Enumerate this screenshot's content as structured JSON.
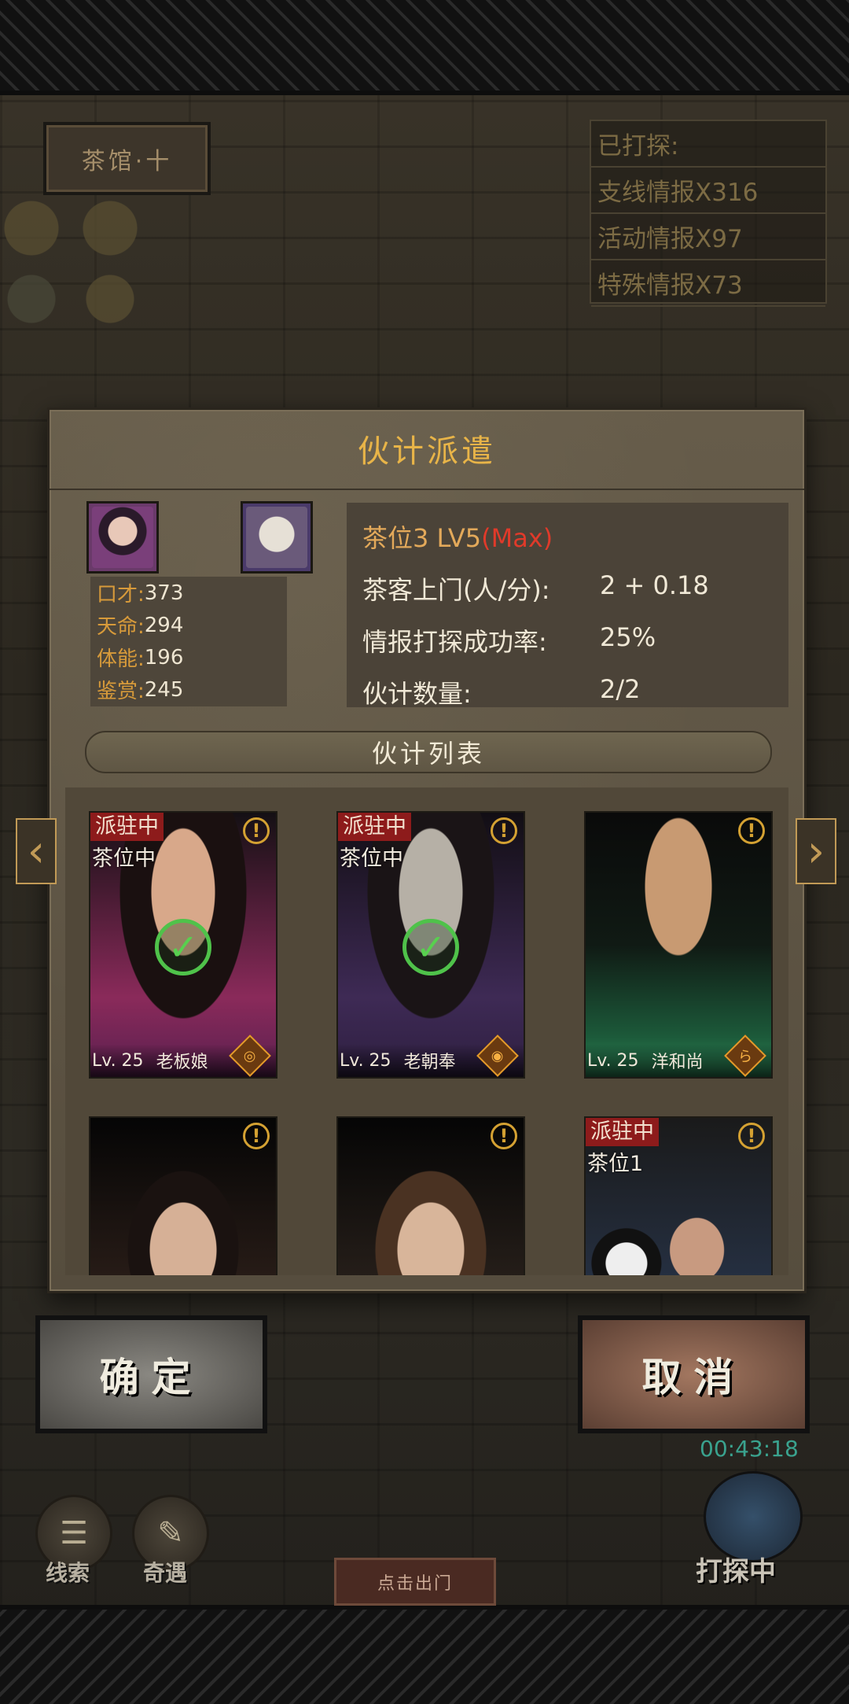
{
  "scene": {
    "shop_sign": "茶馆·十",
    "intel": [
      "已打探:",
      "支线情报X316",
      "活动情报X97",
      "特殊情报X73"
    ]
  },
  "modal": {
    "title": "伙计派遣",
    "stats": [
      {
        "label": "口才:",
        "value": "373"
      },
      {
        "label": "天命:",
        "value": "294"
      },
      {
        "label": "体能:",
        "value": "196"
      },
      {
        "label": "鉴赏:",
        "value": "245"
      }
    ],
    "seat": {
      "name": "茶位3 LV5",
      "max": "(Max)"
    },
    "info": [
      {
        "label": "茶客上门(人/分):",
        "value": "2 + 0.18"
      },
      {
        "label": "情报打探成功率:",
        "value": "25%"
      },
      {
        "label": "伙计数量:",
        "value": "2/2"
      }
    ],
    "list_title": "伙计列表",
    "cards": [
      {
        "badge": "派驻中",
        "seat": "茶位中",
        "level": "Lv. 25",
        "name": "老板娘",
        "checked": true,
        "color": "#8a2a5a",
        "rank": "◎"
      },
      {
        "badge": "派驻中",
        "seat": "茶位中",
        "level": "Lv. 25",
        "name": "老朝奉",
        "checked": true,
        "color": "#3e2a55",
        "rank": "◉"
      },
      {
        "badge": "",
        "seat": "",
        "level": "Lv. 25",
        "name": "洋和尚",
        "checked": false,
        "color": "#1c5a3a",
        "rank": "ら"
      },
      {
        "badge": "",
        "seat": "",
        "level": "",
        "name": "",
        "checked": false,
        "color": "#3d2a22",
        "rank": ""
      },
      {
        "badge": "",
        "seat": "",
        "level": "",
        "name": "",
        "checked": false,
        "color": "#3a2e26",
        "rank": ""
      },
      {
        "badge": "派驻中",
        "seat": "茶位1",
        "level": "",
        "name": "",
        "checked": false,
        "color": "#2c3d5a",
        "rank": ""
      }
    ],
    "info_icon": "!"
  },
  "buttons": {
    "confirm": "确定",
    "cancel": "取消"
  },
  "timer": "00:43:18",
  "bottom": {
    "clues": "线索",
    "encounter": "奇遇",
    "go_out": "点击出门",
    "scouting": "打探中"
  },
  "colors": {
    "accent_gold": "#e8b448",
    "max_red": "#e03a2a",
    "badge_red": "#8d1b1b",
    "check_green": "#4fc24a"
  }
}
